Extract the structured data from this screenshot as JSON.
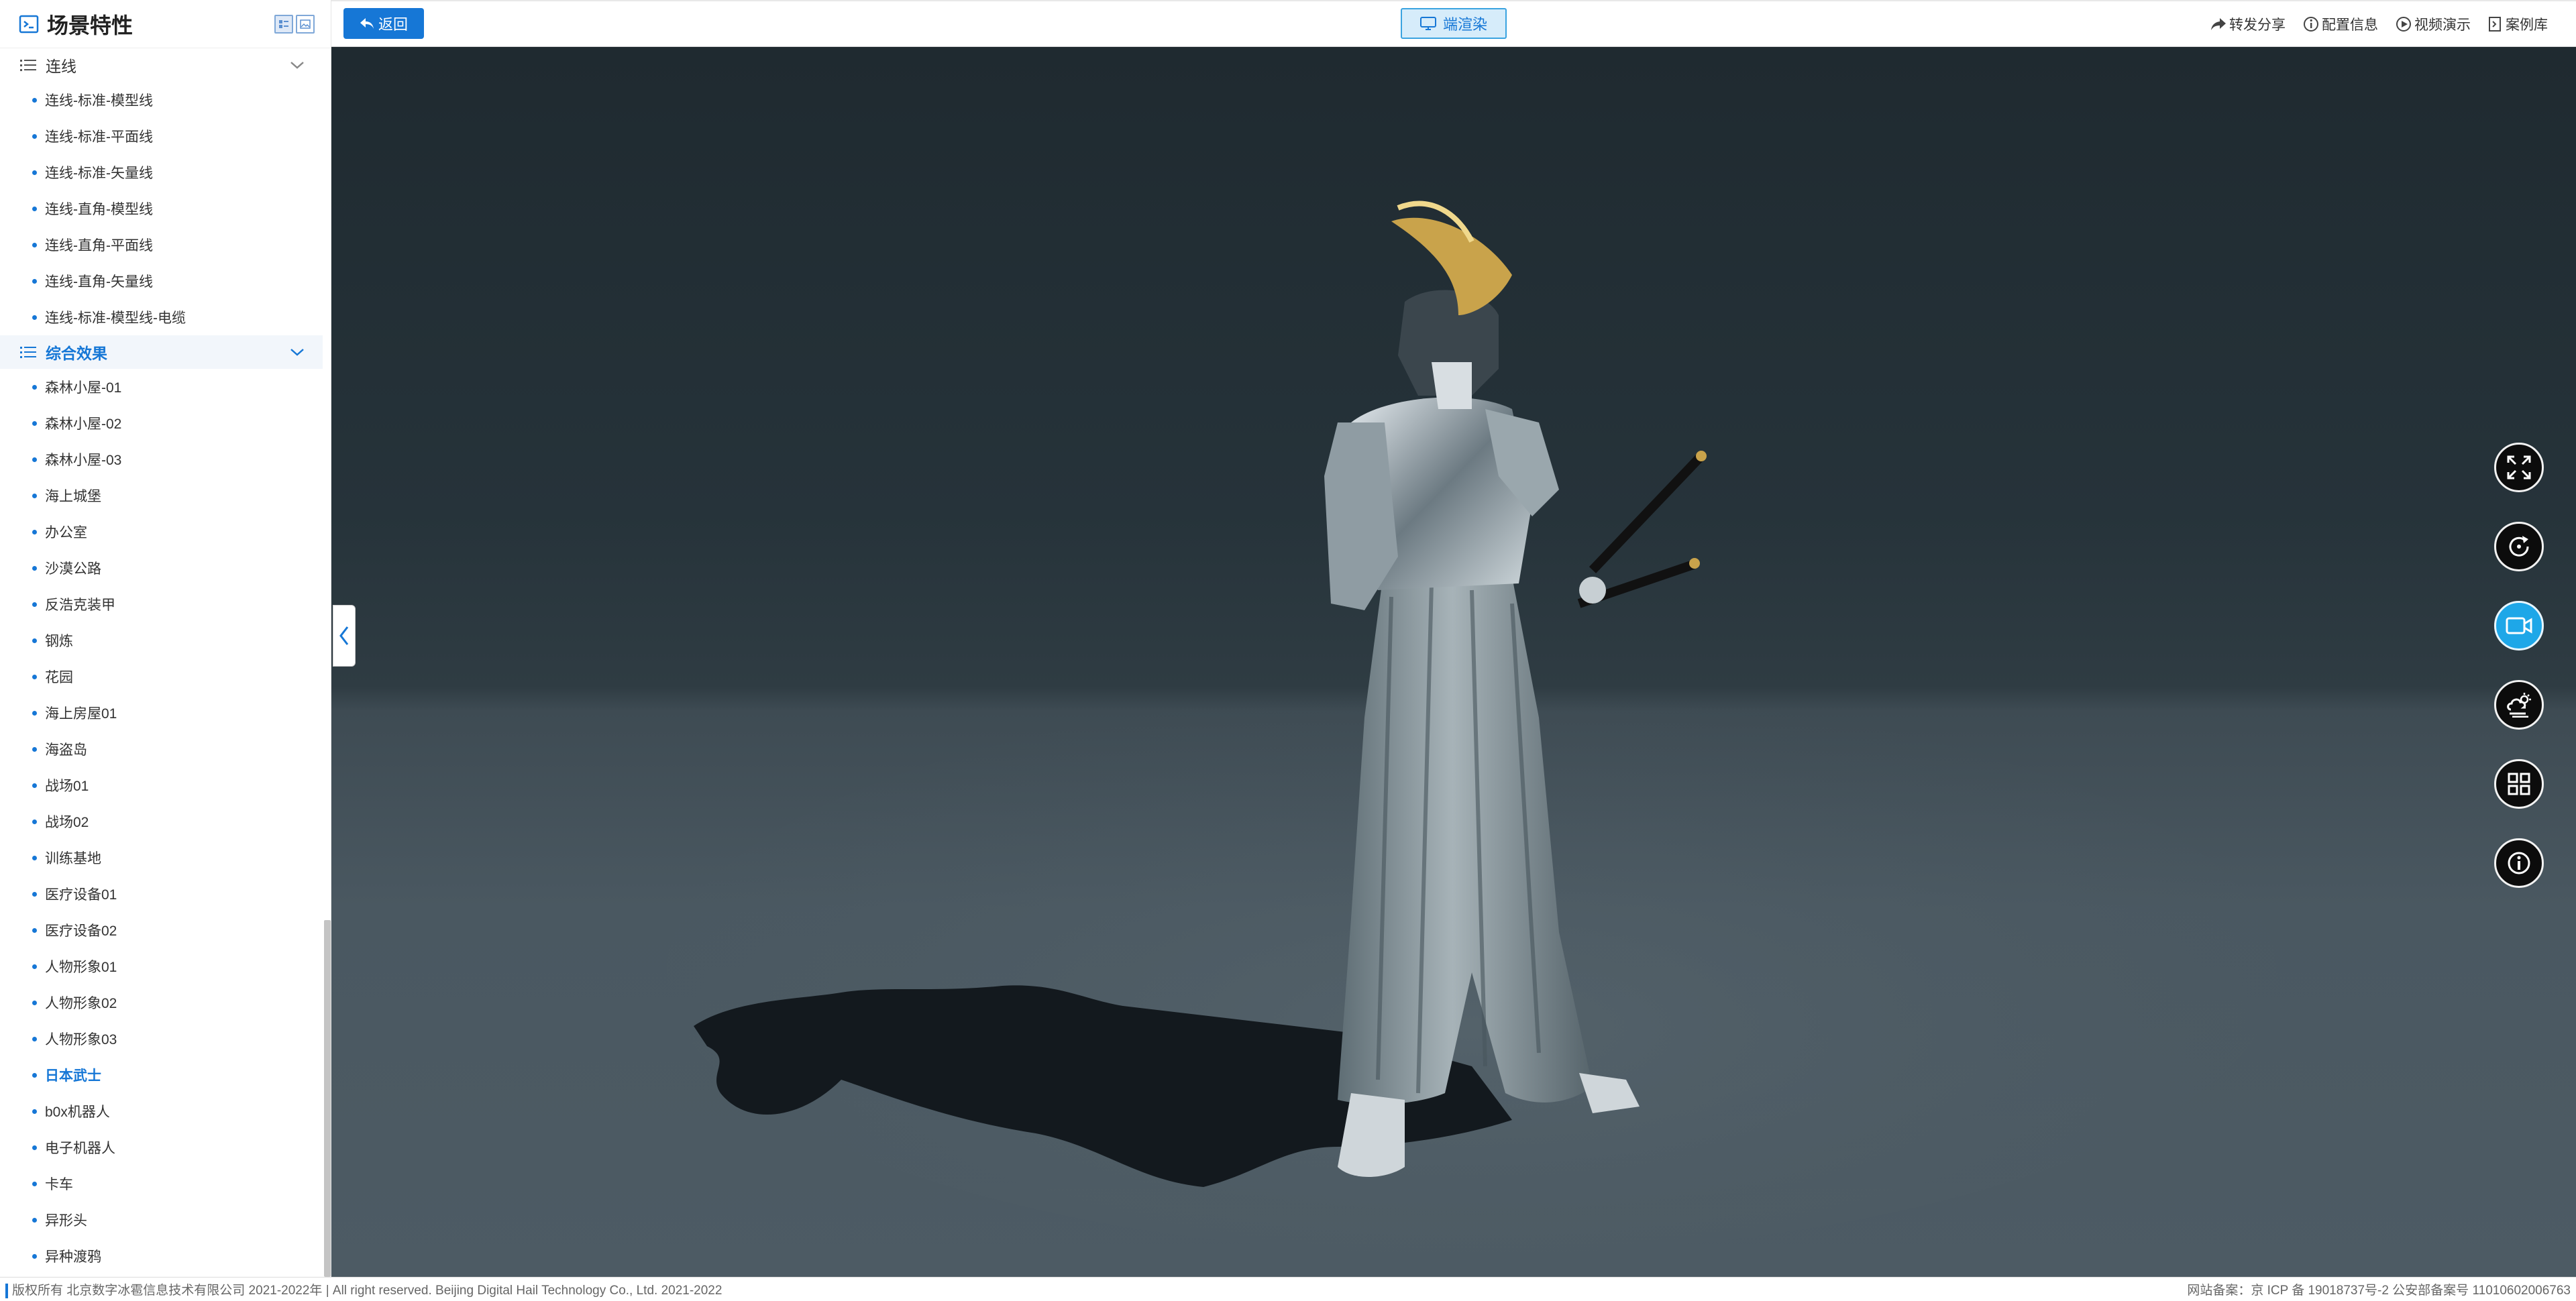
{
  "sidebar": {
    "title": "场景特性",
    "groups": [
      {
        "name": "连线",
        "items": [
          {
            "label": "连线-标准-模型线"
          },
          {
            "label": "连线-标准-平面线"
          },
          {
            "label": "连线-标准-矢量线"
          },
          {
            "label": "连线-直角-模型线"
          },
          {
            "label": "连线-直角-平面线"
          },
          {
            "label": "连线-直角-矢量线"
          },
          {
            "label": "连线-标准-模型线-电缆"
          }
        ]
      },
      {
        "name": "综合效果",
        "items": [
          {
            "label": "森林小屋-01"
          },
          {
            "label": "森林小屋-02"
          },
          {
            "label": "森林小屋-03"
          },
          {
            "label": "海上城堡"
          },
          {
            "label": "办公室"
          },
          {
            "label": "沙漠公路"
          },
          {
            "label": "反浩克装甲"
          },
          {
            "label": "钢炼"
          },
          {
            "label": "花园"
          },
          {
            "label": "海上房屋01"
          },
          {
            "label": "海盗岛"
          },
          {
            "label": "战场01"
          },
          {
            "label": "战场02"
          },
          {
            "label": "训练基地"
          },
          {
            "label": "医疗设备01"
          },
          {
            "label": "医疗设备02"
          },
          {
            "label": "人物形象01"
          },
          {
            "label": "人物形象02"
          },
          {
            "label": "人物形象03"
          },
          {
            "label": "日本武士"
          },
          {
            "label": "b0x机器人"
          },
          {
            "label": "电子机器人"
          },
          {
            "label": "卡车"
          },
          {
            "label": "异形头"
          },
          {
            "label": "异种渡鸦"
          }
        ]
      }
    ],
    "active_group": "综合效果",
    "active_item": "日本武士"
  },
  "topbar": {
    "back_label": "返回",
    "render_label": "端渲染",
    "links": [
      {
        "label": "转发分享",
        "icon": "share-icon"
      },
      {
        "label": "配置信息",
        "icon": "info-icon"
      },
      {
        "label": "视频演示",
        "icon": "play-icon"
      },
      {
        "label": "案例库",
        "icon": "library-icon"
      }
    ]
  },
  "tools": [
    {
      "name": "fullscreen-icon"
    },
    {
      "name": "rotate-icon"
    },
    {
      "name": "camera-icon",
      "active": true
    },
    {
      "name": "weather-icon"
    },
    {
      "name": "grid-icon"
    },
    {
      "name": "info-icon"
    }
  ],
  "footer": {
    "copyright": "版权所有 北京数字冰雹信息技术有限公司 2021-2022年 | All right reserved. Beijing Digital Hail Technology Co., Ltd. 2021-2022",
    "icp": "网站备案：京 ICP 备 19018737号-2 公安部备案号 11010602006763"
  },
  "colors": {
    "accent": "#1677d6",
    "tool_active": "#1ea7e8"
  }
}
